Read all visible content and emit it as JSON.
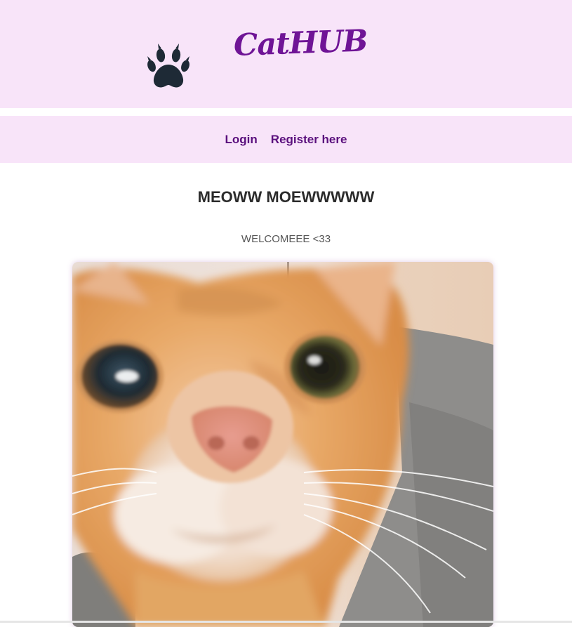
{
  "header": {
    "logo_icon": "paw-print-icon",
    "brand": "CatHUB",
    "background": "#f8e4f9",
    "brand_color": "#6f1496"
  },
  "nav": {
    "links": [
      {
        "label": "Login"
      },
      {
        "label": "Register here"
      }
    ],
    "link_color": "#5a0f7d"
  },
  "main": {
    "heading": "MEOWW MOEWWWWW",
    "subtext": "WELCOMEEE <33",
    "photo": "close-up orange tabby cat photo"
  }
}
